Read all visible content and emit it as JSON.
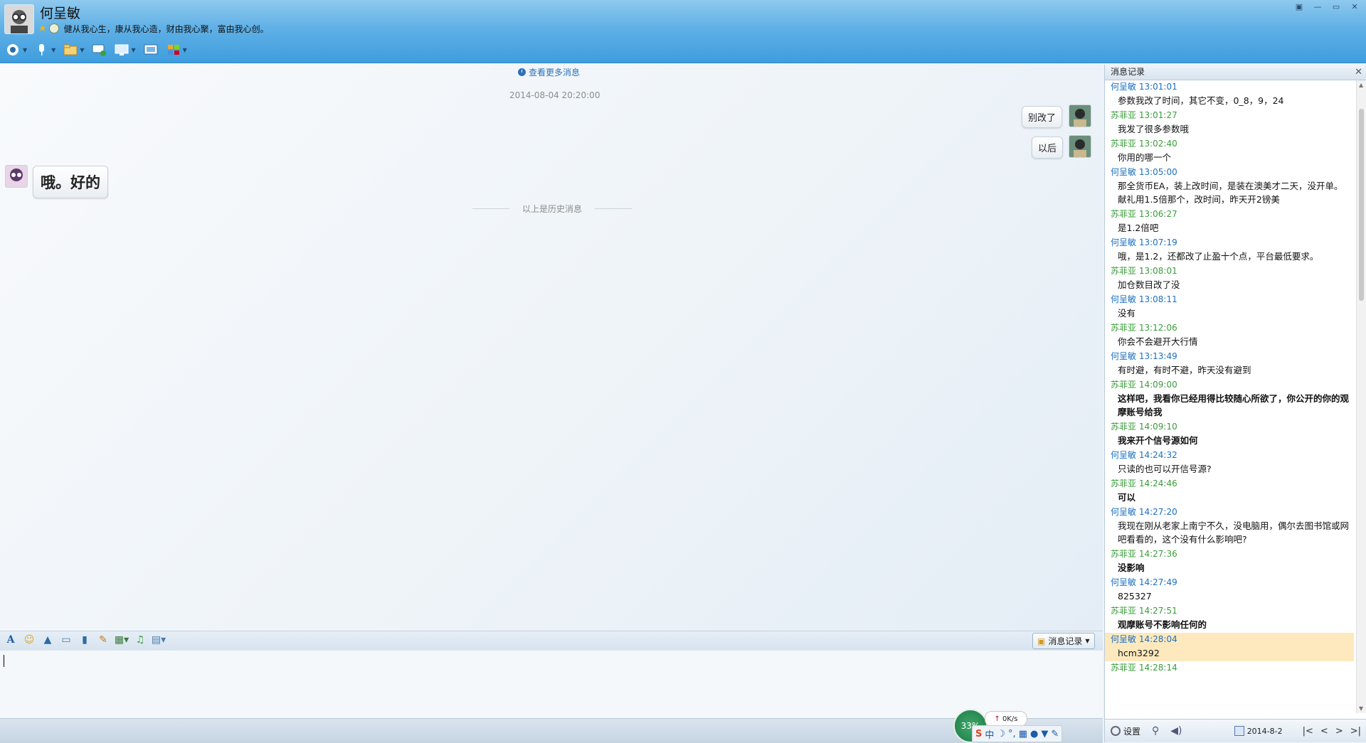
{
  "header": {
    "name": "何呈敏",
    "signature": "健从我心生，康从我心造，财由我心聚，富由我心创。"
  },
  "chat": {
    "more_messages": "查看更多消息",
    "timestamp": "2014-08-04 20:20:00",
    "messages": [
      {
        "side": "right",
        "text": "别改了"
      },
      {
        "side": "right",
        "text": "以后"
      },
      {
        "side": "left",
        "text": "哦。好的"
      }
    ],
    "history_separator": "以上是历史消息"
  },
  "input": {
    "history_button": "消息记录"
  },
  "ime": {
    "percent": "33%",
    "speed": "0K/s",
    "mode": "中"
  },
  "history_panel": {
    "title": "消息记录",
    "entries": [
      {
        "sender": "何呈敏",
        "time": "13:01:01",
        "who": "he",
        "text": "参数我改了时间，其它不变，0_8，9，24",
        "bold": false
      },
      {
        "sender": "苏菲亚",
        "time": "13:01:27",
        "who": "su",
        "text": "我发了很多参数哦",
        "bold": false
      },
      {
        "sender": "苏菲亚",
        "time": "13:02:40",
        "who": "su",
        "text": "你用的哪一个",
        "bold": false
      },
      {
        "sender": "何呈敏",
        "time": "13:05:00",
        "who": "he",
        "text": "那全货币EA，装上改时间，是装在澳美才二天，没开单。献礼用1.5倍那个，改时间，昨天开2镑美",
        "bold": false
      },
      {
        "sender": "苏菲亚",
        "time": "13:06:27",
        "who": "su",
        "text": "是1.2倍吧",
        "bold": false
      },
      {
        "sender": "何呈敏",
        "time": "13:07:19",
        "who": "he",
        "text": "哦，是1.2，还都改了止盈十个点，平台最低要求。",
        "bold": false
      },
      {
        "sender": "苏菲亚",
        "time": "13:08:01",
        "who": "su",
        "text": "加仓数目改了没",
        "bold": false
      },
      {
        "sender": "何呈敏",
        "time": "13:08:11",
        "who": "he",
        "text": "没有",
        "bold": false
      },
      {
        "sender": "苏菲亚",
        "time": "13:12:06",
        "who": "su",
        "text": "你会不会避开大行情",
        "bold": false
      },
      {
        "sender": "何呈敏",
        "time": "13:13:49",
        "who": "he",
        "text": "有时避，有时不避，昨天没有避到",
        "bold": false
      },
      {
        "sender": "苏菲亚",
        "time": "14:09:00",
        "who": "su",
        "text": "这样吧，我看你已经用得比较随心所欲了，你公开的你的观摩账号给我",
        "bold": true
      },
      {
        "sender": "苏菲亚",
        "time": "14:09:10",
        "who": "su",
        "text": "我来开个信号源如何",
        "bold": true
      },
      {
        "sender": "何呈敏",
        "time": "14:24:32",
        "who": "he",
        "text": "只读的也可以开信号源?",
        "bold": false
      },
      {
        "sender": "苏菲亚",
        "time": "14:24:46",
        "who": "su",
        "text": "可以",
        "bold": true
      },
      {
        "sender": "何呈敏",
        "time": "14:27:20",
        "who": "he",
        "text": "我现在刚从老家上南宁不久，没电脑用，偶尔去图书馆或网吧看看的，这个没有什么影响吧?",
        "bold": false
      },
      {
        "sender": "苏菲亚",
        "time": "14:27:36",
        "who": "su",
        "text": "没影响",
        "bold": true
      },
      {
        "sender": "何呈敏",
        "time": "14:27:49",
        "who": "he",
        "text": "825327",
        "bold": false
      },
      {
        "sender": "苏菲亚",
        "time": "14:27:51",
        "who": "su",
        "text": "观摩账号不影响任何的",
        "bold": true
      },
      {
        "sender": "何呈敏",
        "time": "14:28:04",
        "who": "he",
        "text": "hcm3292",
        "bold": false,
        "highlight": true
      },
      {
        "sender": "苏菲亚",
        "time": "14:28:14",
        "who": "su",
        "text": "",
        "bold": false
      }
    ],
    "settings_label": "设置",
    "date": "2014-8-2"
  }
}
